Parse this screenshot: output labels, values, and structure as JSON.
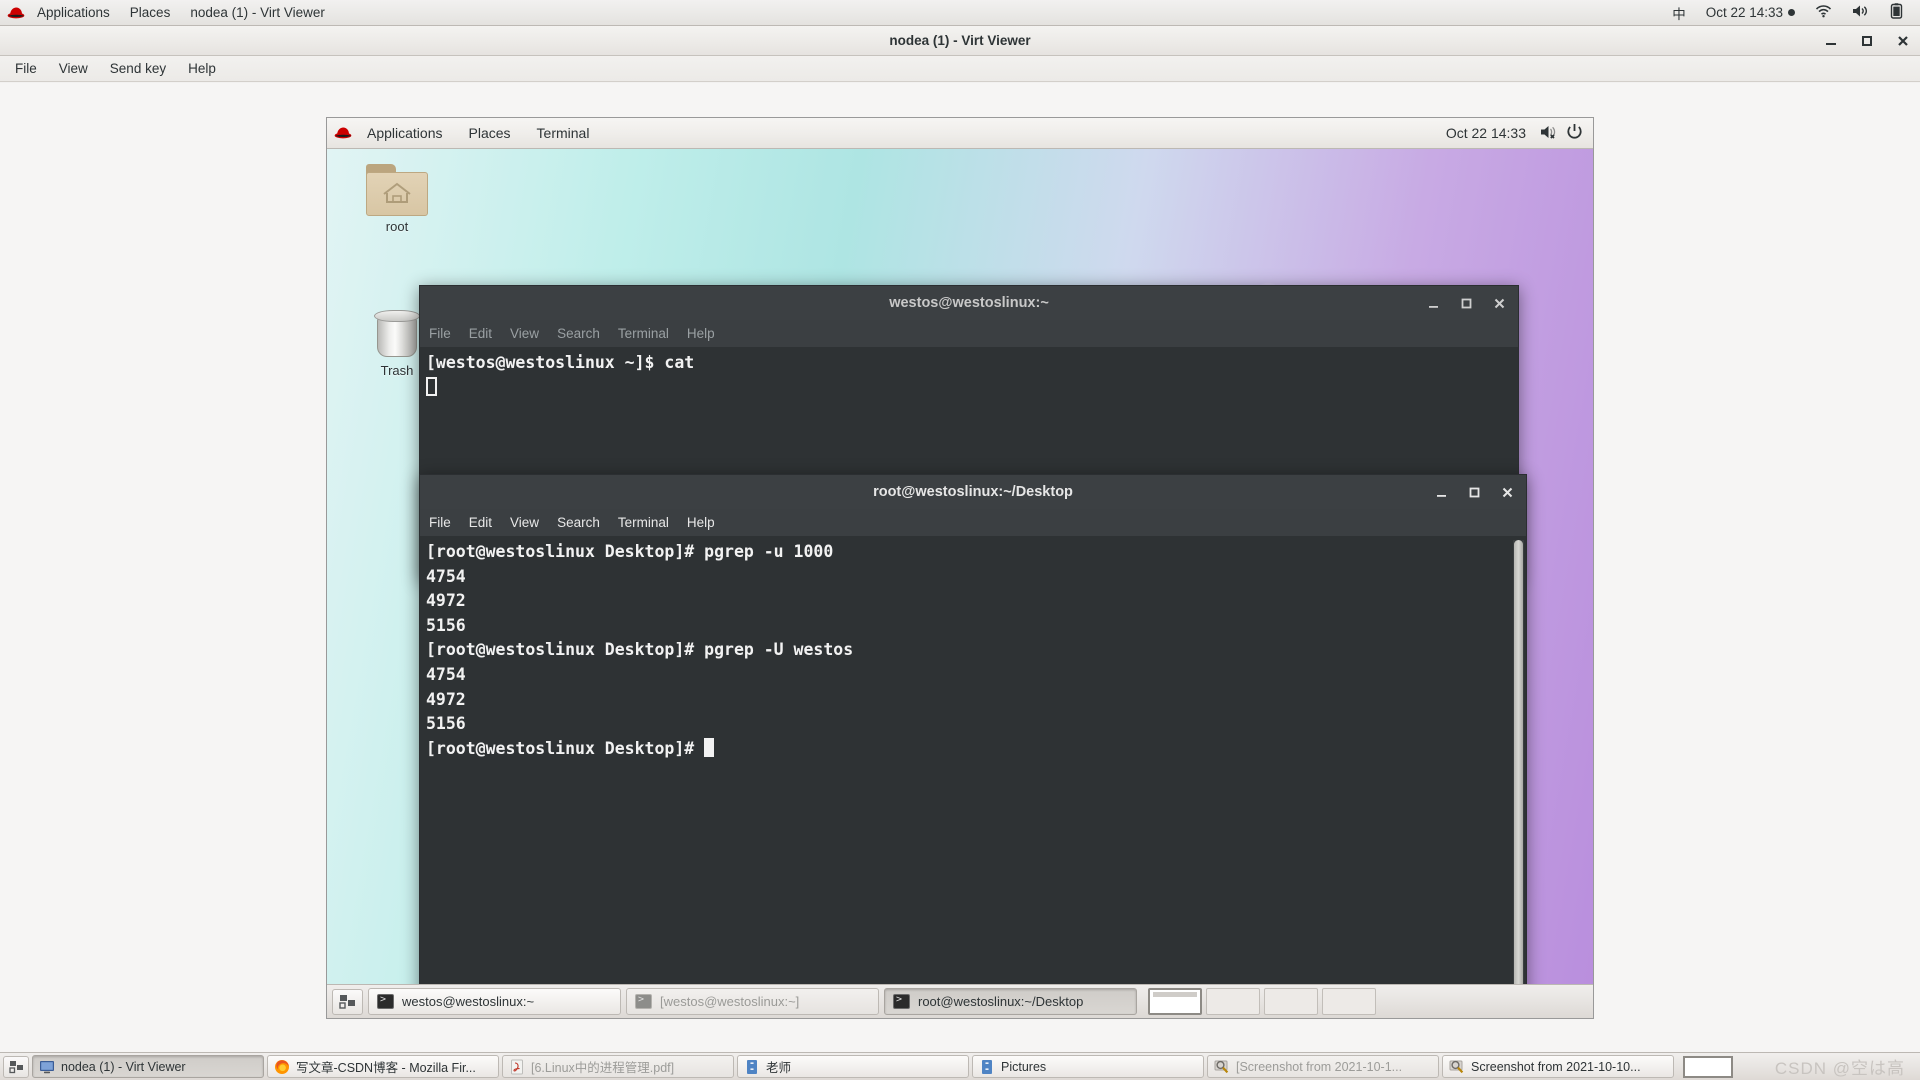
{
  "host": {
    "top_panel": {
      "logo_icon": "redhat-logo-icon",
      "applications_label": "Applications",
      "places_label": "Places",
      "window_label": "nodea (1) - Virt Viewer",
      "input_method": "中",
      "clock": "Oct 22  14:33",
      "recording_dot": "●",
      "network_icon": "wifi-icon",
      "volume_icon": "volume-icon",
      "battery_icon": "battery-icon"
    },
    "taskbar": {
      "show_desktop_icon": "show-desktop-icon",
      "items": [
        {
          "label": "nodea (1) - Virt Viewer",
          "icon": "virt-viewer-icon",
          "state": "pressed"
        },
        {
          "label": "写文章-CSDN博客 - Mozilla Fir...",
          "icon": "firefox-icon",
          "state": "normal"
        },
        {
          "label": "[6.Linux中的进程管理.pdf]",
          "icon": "pdf-icon",
          "state": "minimized"
        },
        {
          "label": "老师",
          "icon": "file-manager-icon",
          "state": "normal"
        },
        {
          "label": "Pictures",
          "icon": "file-manager-icon",
          "state": "normal"
        },
        {
          "label": "[Screenshot from 2021-10-1...",
          "icon": "image-viewer-icon",
          "state": "minimized"
        },
        {
          "label": "Screenshot from 2021-10-10...",
          "icon": "image-viewer-icon",
          "state": "normal"
        }
      ],
      "workspace_switcher": "workspace-switcher",
      "watermark": "CSDN @空は高"
    }
  },
  "virt_viewer": {
    "title": "nodea (1) - Virt Viewer",
    "menu": [
      "File",
      "View",
      "Send key",
      "Help"
    ],
    "window_buttons": {
      "minimize": "minimize-icon",
      "maximize": "maximize-icon",
      "close": "close-icon"
    }
  },
  "guest": {
    "top_panel": {
      "logo_icon": "redhat-logo-icon",
      "applications_label": "Applications",
      "places_label": "Places",
      "active_app_label": "Terminal",
      "clock": "Oct 22  14:33",
      "volume_icon": "volume-muted-icon",
      "power_icon": "power-icon"
    },
    "desktop_icons": [
      {
        "label": "root",
        "icon": "home-folder-icon"
      },
      {
        "label": "Trash",
        "icon": "trash-icon"
      }
    ],
    "terminals": [
      {
        "title": "westos@westoslinux:~",
        "active": false,
        "menu": [
          "File",
          "Edit",
          "View",
          "Search",
          "Terminal",
          "Help"
        ],
        "lines": [
          "[westos@westoslinux ~]$ cat"
        ],
        "cursor": "hollow"
      },
      {
        "title": "root@westoslinux:~/Desktop",
        "active": true,
        "menu": [
          "File",
          "Edit",
          "View",
          "Search",
          "Terminal",
          "Help"
        ],
        "lines": [
          "[root@westoslinux Desktop]# pgrep -u 1000",
          "4754",
          "4972",
          "5156",
          "[root@westoslinux Desktop]# pgrep -U westos",
          "4754",
          "4972",
          "5156"
        ],
        "prompt": "[root@westoslinux Desktop]# ",
        "cursor": "block",
        "scrollbar": "vertical-scrollbar"
      }
    ],
    "taskbar": {
      "show_desktop_icon": "show-desktop-icon",
      "items": [
        {
          "label": "westos@westoslinux:~",
          "icon": "terminal-icon",
          "state": "normal"
        },
        {
          "label": "[westos@westoslinux:~]",
          "icon": "terminal-icon",
          "state": "minimized"
        },
        {
          "label": "root@westoslinux:~/Desktop",
          "icon": "terminal-icon",
          "state": "pressed"
        }
      ],
      "workspaces": [
        "1",
        "2",
        "3",
        "4"
      ],
      "active_workspace": 0
    }
  }
}
